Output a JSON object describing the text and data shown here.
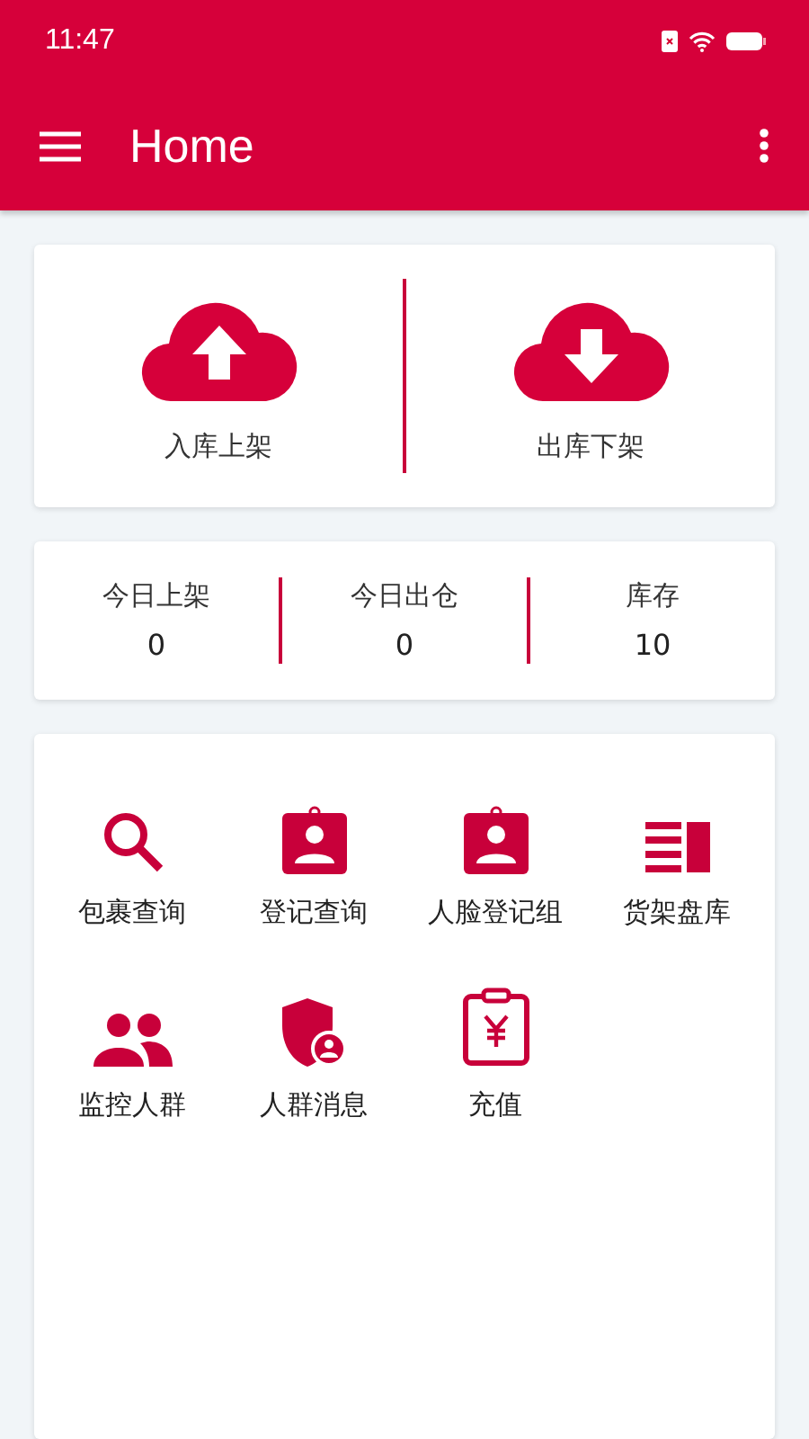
{
  "status_bar": {
    "time": "11:47"
  },
  "app_bar": {
    "title": "Home"
  },
  "actions": [
    {
      "label": "入库上架",
      "kind": "upload"
    },
    {
      "label": "出库下架",
      "kind": "download"
    }
  ],
  "stats": [
    {
      "label": "今日上架",
      "value": "0"
    },
    {
      "label": "今日出仓",
      "value": "0"
    },
    {
      "label": "库存",
      "value": "10"
    }
  ],
  "menu": [
    {
      "label": "包裹查询",
      "kind": "search"
    },
    {
      "label": "登记查询",
      "kind": "badge"
    },
    {
      "label": "人脸登记组",
      "kind": "badge"
    },
    {
      "label": "货架盘库",
      "kind": "shelf"
    },
    {
      "label": "监控人群",
      "kind": "people"
    },
    {
      "label": "人群消息",
      "kind": "shield"
    },
    {
      "label": "充值",
      "kind": "recharge"
    }
  ]
}
